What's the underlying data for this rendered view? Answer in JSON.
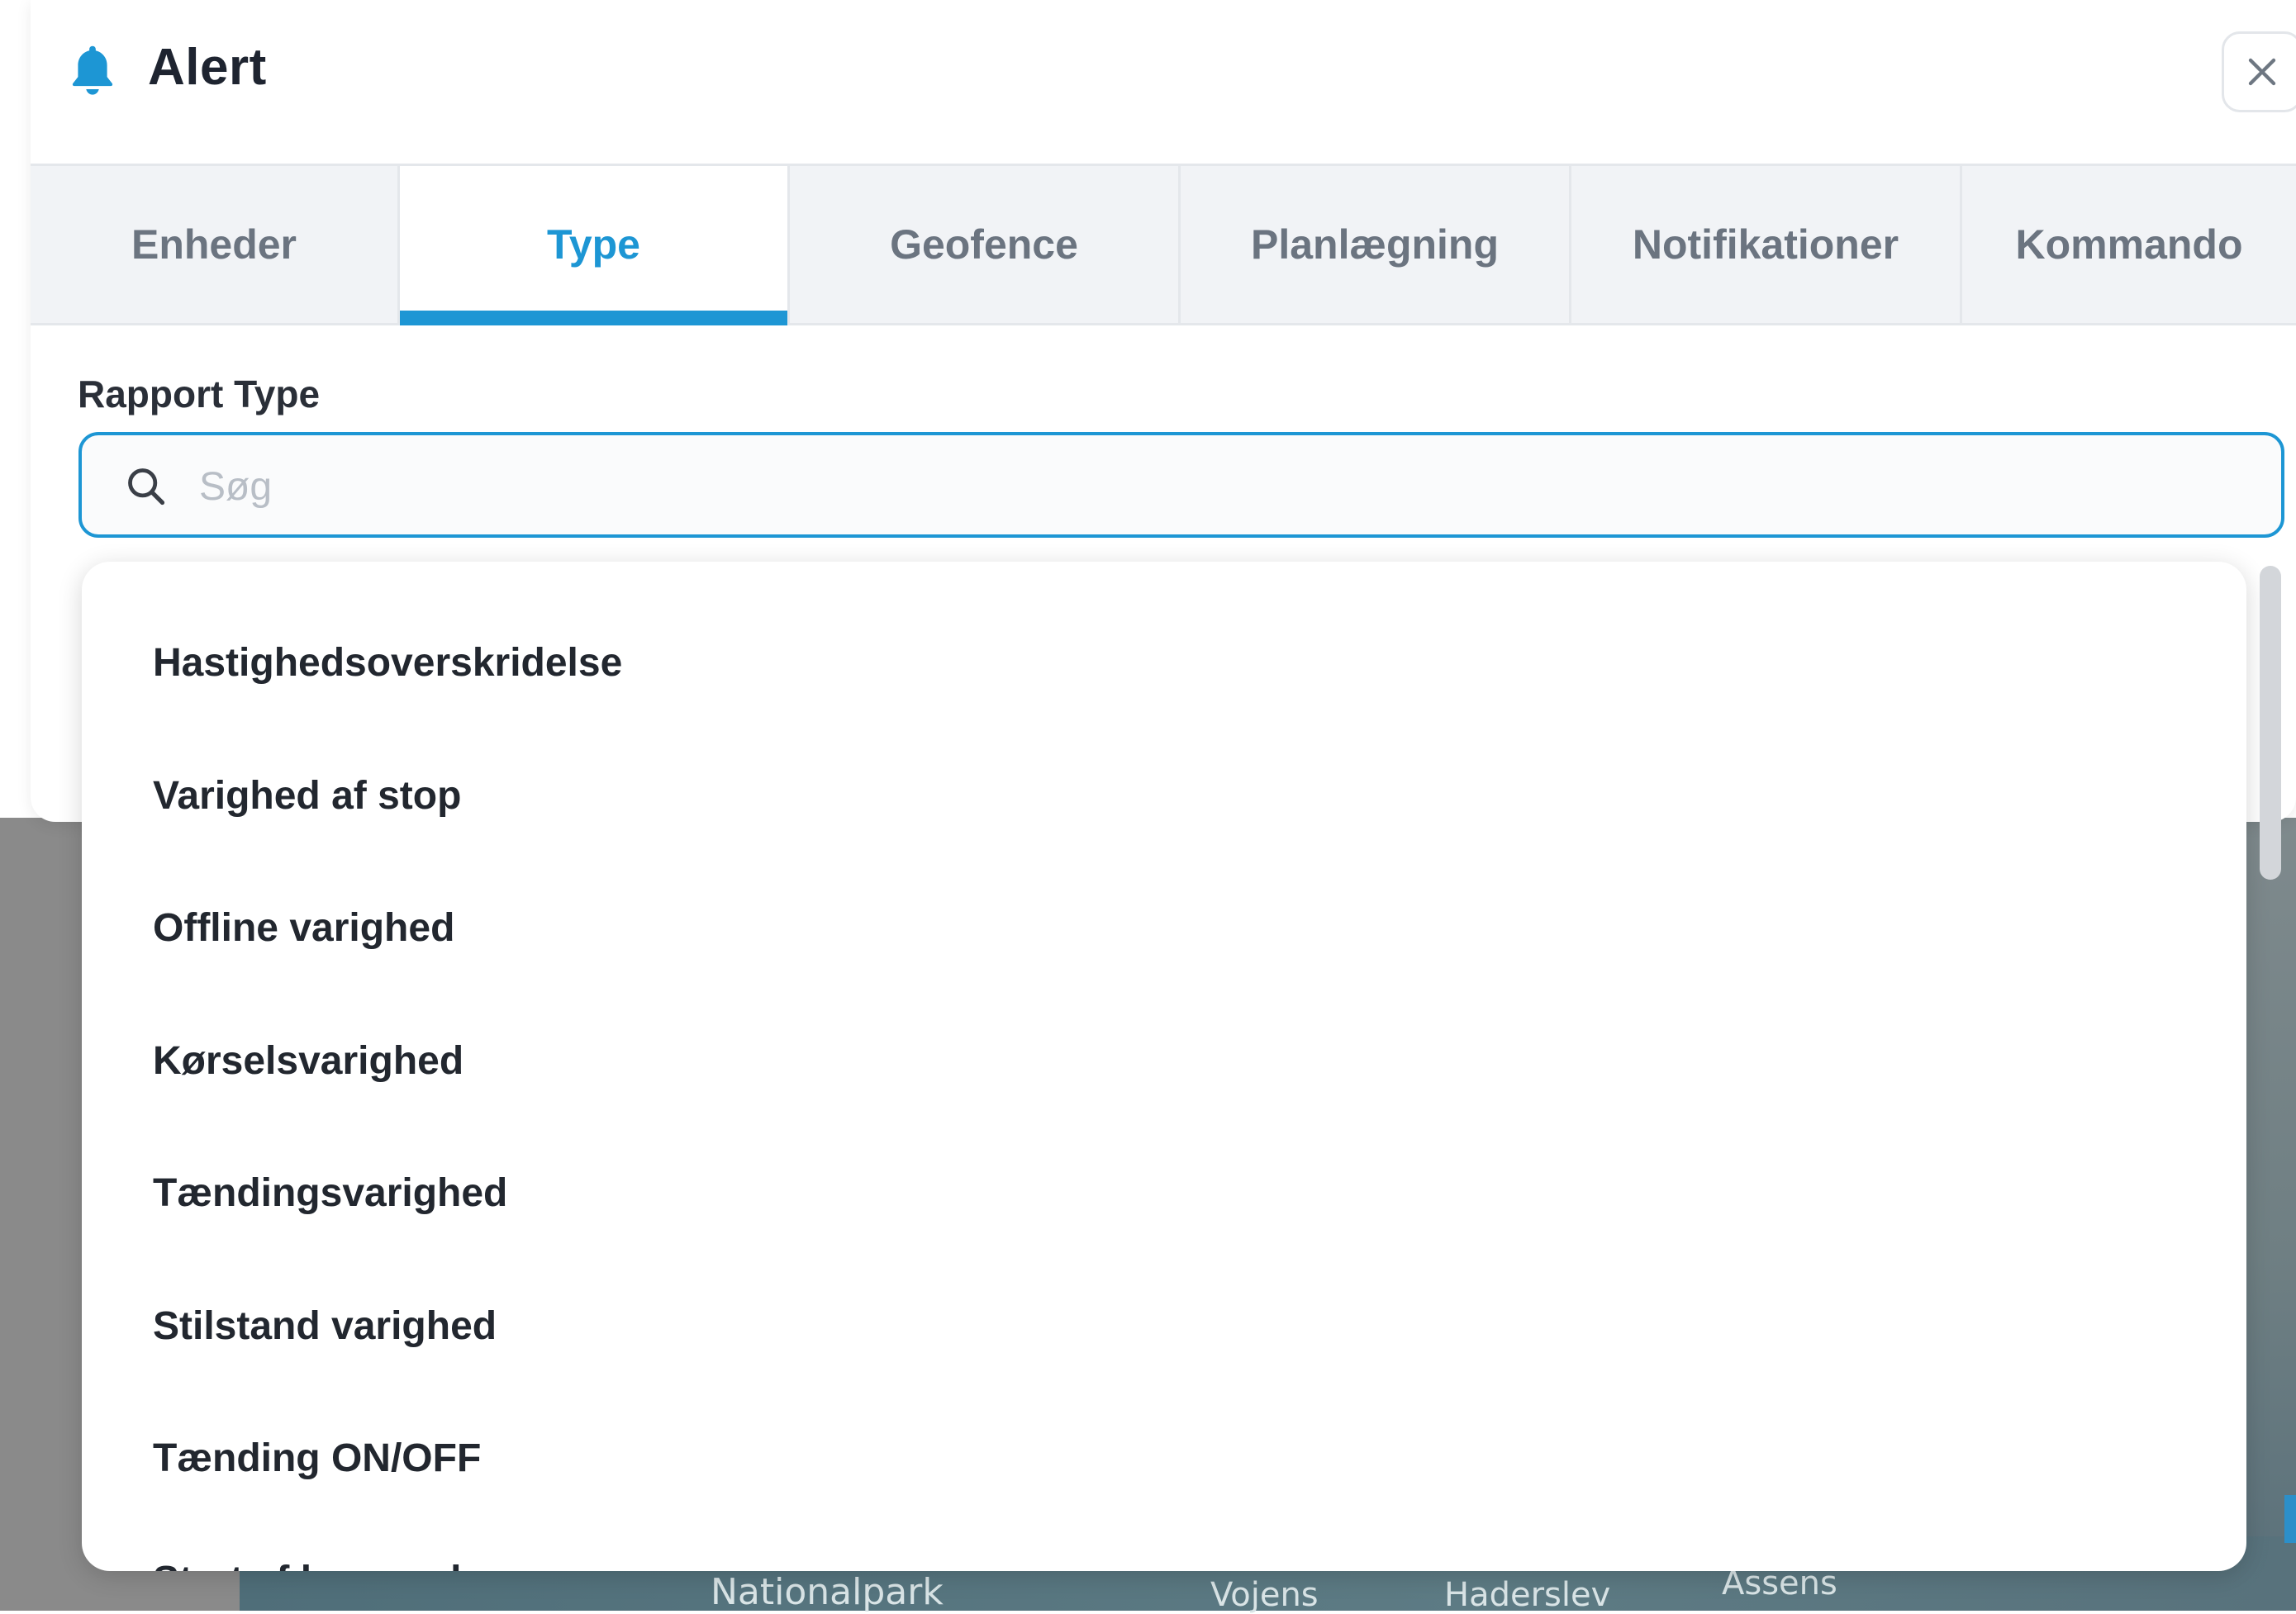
{
  "modal": {
    "title": "Alert",
    "title_icon": "bell-icon",
    "close_icon": "close-icon",
    "accent_color": "#1d96d4"
  },
  "tabs": [
    {
      "label": "Enheder",
      "active": false
    },
    {
      "label": "Type",
      "active": true
    },
    {
      "label": "Geofence",
      "active": false
    },
    {
      "label": "Planlægning",
      "active": false
    },
    {
      "label": "Notifikationer",
      "active": false
    },
    {
      "label": "Kommando",
      "active": false
    }
  ],
  "report_type": {
    "label": "Rapport Type",
    "search_placeholder": "Søg",
    "search_value": "",
    "options": [
      "Hastighedsoverskridelse",
      "Varighed af stop",
      "Offline varighed",
      "Kørselsvarighed",
      "Tændingsvarighed",
      "Stilstand varighed",
      "Tænding ON/OFF",
      "Start af bevægelse"
    ]
  },
  "map": {
    "labels": [
      "Nationalpark",
      "Vojens",
      "Haderslev",
      "Assens"
    ]
  }
}
